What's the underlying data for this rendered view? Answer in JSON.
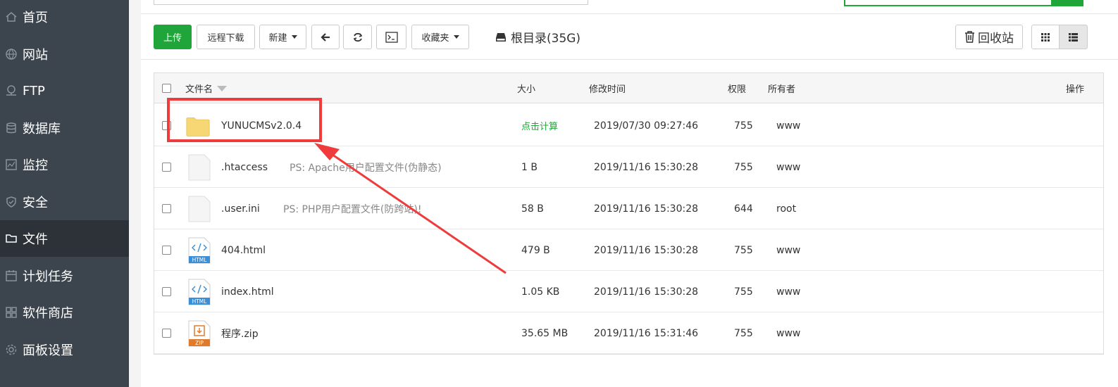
{
  "sidebar": {
    "items": [
      {
        "label": "首页",
        "icon": "home-icon"
      },
      {
        "label": "网站",
        "icon": "globe-icon"
      },
      {
        "label": "FTP",
        "icon": "network-icon"
      },
      {
        "label": "数据库",
        "icon": "database-icon"
      },
      {
        "label": "监控",
        "icon": "monitor-icon"
      },
      {
        "label": "安全",
        "icon": "shield-icon"
      },
      {
        "label": "文件",
        "icon": "folder-icon",
        "active": true
      },
      {
        "label": "计划任务",
        "icon": "calendar-icon"
      },
      {
        "label": "软件商店",
        "icon": "grid-icon"
      },
      {
        "label": "面板设置",
        "icon": "gear-icon"
      }
    ]
  },
  "toolbar": {
    "upload": "上传",
    "remote_download": "远程下载",
    "new": "新建",
    "back_icon": "arrow-left-icon",
    "refresh_icon": "refresh-icon",
    "terminal_icon": "terminal-icon",
    "favorites": "收藏夹",
    "disk_label": "根目录(35G)",
    "recycle_bin": "回收站"
  },
  "table": {
    "headers": {
      "name": "文件名",
      "size": "大小",
      "mtime": "修改时间",
      "perm": "权限",
      "owner": "所有者",
      "ops": "操作"
    },
    "rows": [
      {
        "name": "YUNUCMSv2.0.4",
        "type": "folder",
        "note": "",
        "size": "点击计算",
        "mtime": "2019/07/30 09:27:46",
        "perm": "755",
        "owner": "www"
      },
      {
        "name": ".htaccess",
        "type": "file",
        "note": "PS: Apache用户配置文件(伪静态)",
        "size": "1 B",
        "mtime": "2019/11/16 15:30:28",
        "perm": "755",
        "owner": "www"
      },
      {
        "name": ".user.ini",
        "type": "file",
        "note": "PS: PHP用户配置文件(防跨站)!",
        "size": "58 B",
        "mtime": "2019/11/16 15:30:28",
        "perm": "644",
        "owner": "root"
      },
      {
        "name": "404.html",
        "type": "html",
        "note": "",
        "size": "479 B",
        "mtime": "2019/11/16 15:30:28",
        "perm": "755",
        "owner": "www"
      },
      {
        "name": "index.html",
        "type": "html",
        "note": "",
        "size": "1.05 KB",
        "mtime": "2019/11/16 15:30:28",
        "perm": "755",
        "owner": "www"
      },
      {
        "name": "程序.zip",
        "type": "zip",
        "note": "",
        "size": "35.65 MB",
        "mtime": "2019/11/16 15:31:46",
        "perm": "755",
        "owner": "www"
      }
    ],
    "html_badge": "HTML",
    "zip_badge": "ZIP"
  },
  "colors": {
    "accent": "#20a53a",
    "sidebar": "#3c444d",
    "annotation": "#ef3b3b"
  }
}
